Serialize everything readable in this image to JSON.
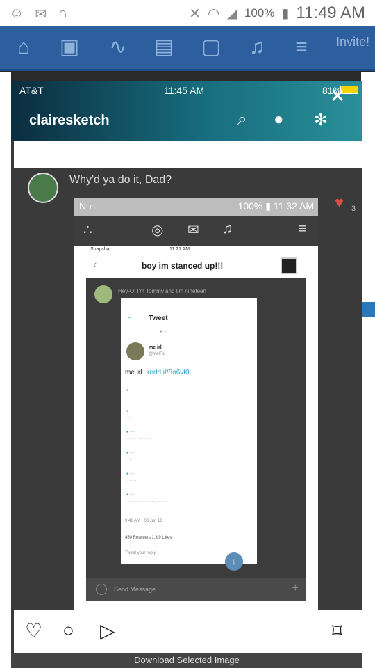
{
  "status_bar": {
    "battery_pct": "100%",
    "time": "11:49 AM"
  },
  "nav": {
    "invite_label": "Invite!"
  },
  "popup": {
    "carrier": "AT&T",
    "time": "11:45 AM",
    "battery": "81%",
    "username": "clairesketch",
    "comment_text": "Why'd ya do it, Dad?",
    "like_count": "3"
  },
  "nested": {
    "battery": "100%",
    "time": "11:32 AM",
    "snapchat_time": "11:21 AM",
    "snapchat_label": "Snapchat",
    "chat_title": "boy im stanced up!!!",
    "chat_msg": "Hey-O! I'm Tommy and I'm nineteen",
    "tweet_header": "Tweet",
    "tweet_name": "me irl",
    "tweet_handle": "@MeIRL",
    "tweet_text": "me irl",
    "tweet_link": "redd.it/8o6vt0",
    "timestamp": "9:46 AM · 03 Jun 18",
    "retweets": "450 Retweets   1,3/9 Likes",
    "reply_placeholder": "Tweet your reply",
    "send_placeholder": "Send Message..."
  },
  "bottom": {
    "download_label": "Download Selected Image"
  }
}
